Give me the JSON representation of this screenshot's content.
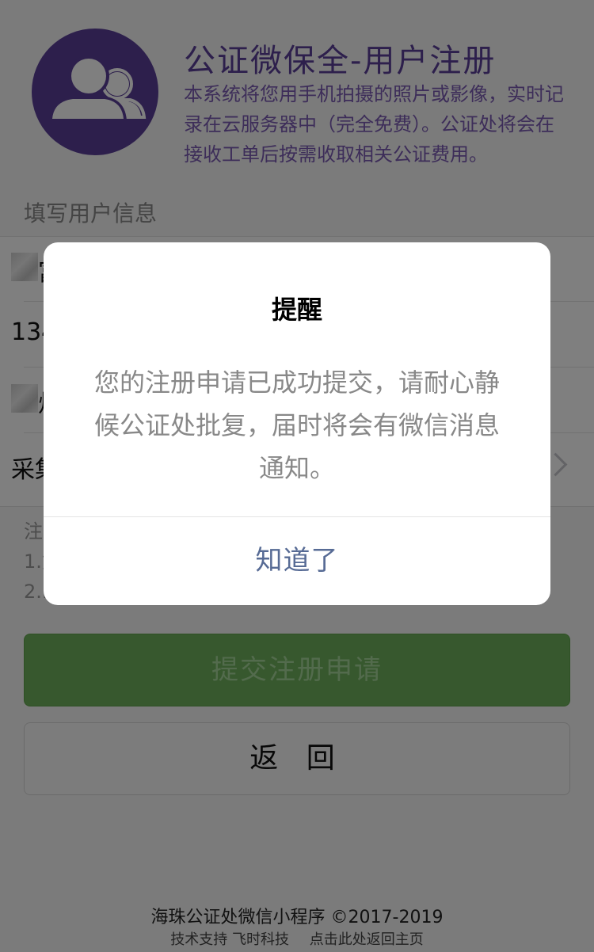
{
  "header": {
    "title": "公证微保全-用户注册",
    "description": "本系统将您用手机拍摄的照片或影像，实时记录在云服务器中（完全免费）。公证处将会在接收工单后按需收取相关公证费用。"
  },
  "form": {
    "section_label": "填写用户信息",
    "rows": [
      {
        "text": "富"
      },
      {
        "text": "134"
      },
      {
        "text": "烦"
      },
      {
        "text": "采集"
      }
    ]
  },
  "notes": {
    "lines": [
      "注",
      "1.如",
      "2.:"
    ]
  },
  "buttons": {
    "submit_label": "提交注册申请",
    "back_label": "返 回"
  },
  "footer": {
    "main": "海珠公证处微信小程序 ©2017-2019",
    "sub_left": "技术支持 飞时科技",
    "sub_right": "点击此处返回主页"
  },
  "modal": {
    "title": "提醒",
    "content": "您的注册申请已成功提交，请耐心静候公证处批复，届时将会有微信消息通知。",
    "confirm_label": "知道了"
  },
  "colors": {
    "brand_purple": "#5a3f99",
    "submit_green": "#6fb15c",
    "modal_link": "#576b95"
  },
  "icons": {
    "avatar": "users-group-icon",
    "row_arrow": "chevron-right-icon"
  }
}
